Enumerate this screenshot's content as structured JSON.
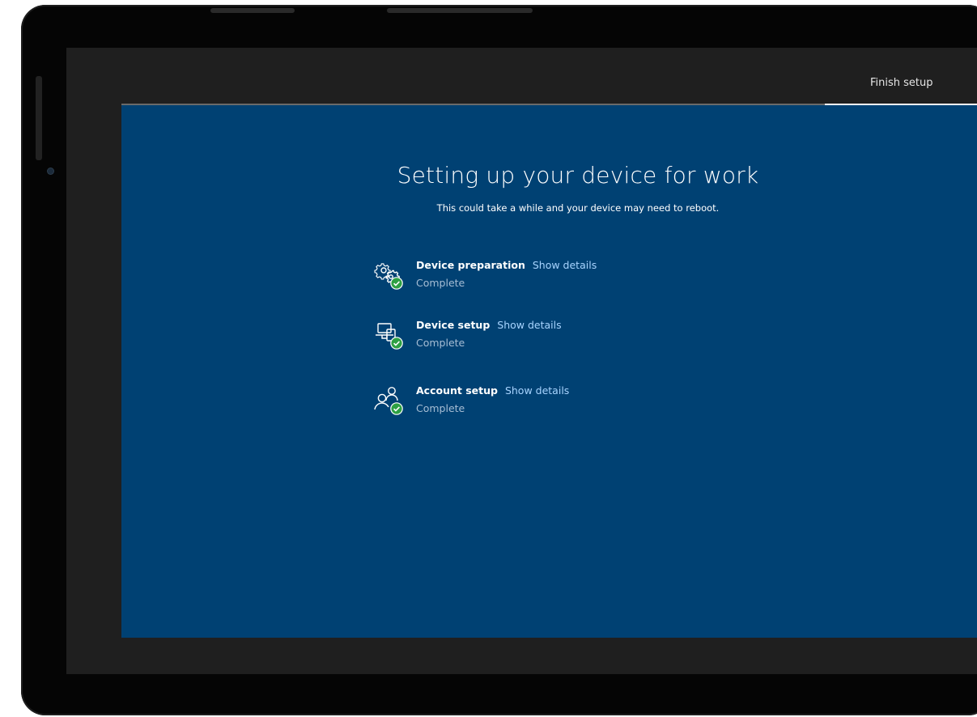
{
  "header": {
    "step_label": "Finish setup"
  },
  "main": {
    "title": "Setting up your device for work",
    "subtitle": "This could take a while and your device may need to reboot.",
    "link_color": "#a8d4ff",
    "panel_color": "#004173",
    "check_color": "#2ea043",
    "items": [
      {
        "label": "Device preparation",
        "link": "Show details",
        "status": "Complete",
        "icon": "gears-icon"
      },
      {
        "label": "Device setup",
        "link": "Show details",
        "status": "Complete",
        "icon": "devices-icon"
      },
      {
        "label": "Account setup",
        "link": "Show details",
        "status": "Complete",
        "icon": "people-icon"
      }
    ]
  }
}
